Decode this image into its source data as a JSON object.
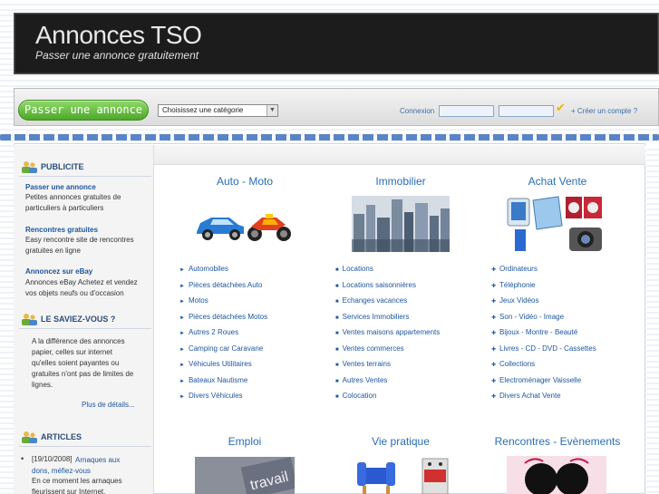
{
  "header": {
    "title": "Annonces TSO",
    "subtitle": "Passer une annonce gratuitement"
  },
  "toolbar": {
    "post_button": "Passer une annonce",
    "category_select": "Choisissez une catégorie",
    "login_label": "Connexion",
    "create_account": "+ Créer un compte ?"
  },
  "sidebar": {
    "publicite_title": "PUBLICITE",
    "ads": [
      {
        "link": "Passer une annonce",
        "text1": "Petites annonces gratuites de",
        "text2": "particuliers à particuliers"
      },
      {
        "link": "Rencontres gratuites",
        "text1": "Easy rencontre site de rencontres",
        "text2": "gratuites en ligne"
      },
      {
        "link": "Annoncez sur eBay",
        "text1": "Annonces eBay Achetez et vendez",
        "text2": "vos objets neufs ou d'occasion"
      }
    ],
    "saviez_title": "LE SAVIEZ-VOUS ?",
    "saviez_lines": [
      "A la différence des annonces",
      "papier, celles sur internet",
      "qu'elles soient payantes ou",
      "gratuites n'ont pas de limites de",
      "lignes."
    ],
    "more_link": "Plus de détails...",
    "articles_title": "ARTICLES",
    "article": {
      "date": "[19/10/2008]",
      "link1": "Arnaques aux",
      "link2": "dons, méfiez-vous",
      "text1": "En ce moment les arnaques",
      "text2": "fleurissent sur Internet."
    }
  },
  "categories": [
    {
      "title": "Auto - Moto",
      "items": [
        "Automobiles",
        "Pièces détachées Auto",
        "Motos",
        "Pièces détachées Motos",
        "Autres 2 Roues",
        "Camping car Caravane",
        "Véhicules Utilitaires",
        "Bateaux Nautisme",
        "Divers Véhicules"
      ]
    },
    {
      "title": "Immobilier",
      "items": [
        "Locations",
        "Locations saisonnières",
        "Echanges vacances",
        "Services Immobiliers",
        "Ventes maisons appartements",
        "Ventes commerces",
        "Ventes terrains",
        "Autres Ventes",
        "Colocation"
      ]
    },
    {
      "title": "Achat Vente",
      "items": [
        "Ordinateurs",
        "Téléphonie",
        "Jeux Vidéos",
        "Son - Vidéo - Image",
        "Bijoux - Montre - Beauté",
        "Livres - CD - DVD - Cassettes",
        "Collections",
        "Electroménager Vaisselle",
        "Divers Achat Vente"
      ]
    }
  ],
  "bottom_categories": {
    "emploi": "Emploi",
    "vie": "Vie pratique",
    "rencontres": "Rencontres - Evènements",
    "travail_word": "travail"
  },
  "icons": {
    "people": "people-icon",
    "check": "checkmark-icon",
    "bullet_arrow": "arrow-bullet-icon",
    "bullet_square": "square-bullet-icon",
    "bullet_plus": "plus-bullet-icon"
  },
  "colors": {
    "accent_blue": "#2a6db4",
    "link_blue": "#1e56a0",
    "button_green": "#4da82a",
    "header_bg": "#1c1c1c"
  }
}
